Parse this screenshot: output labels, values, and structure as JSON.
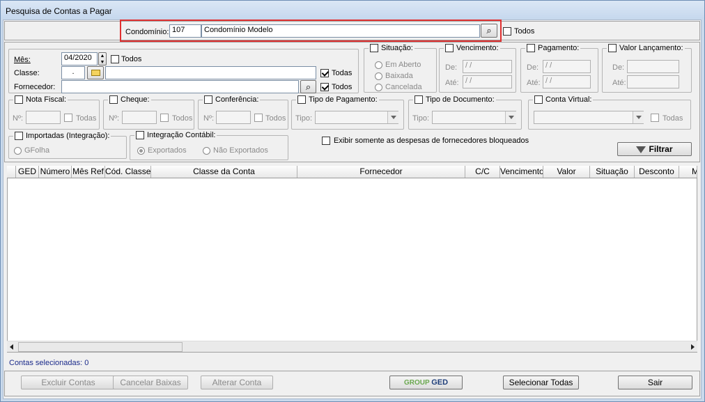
{
  "window": {
    "title": "Pesquisa de Contas a Pagar"
  },
  "condominio": {
    "label": "Condomínio:",
    "code": "107",
    "name": "Condomínio Modelo",
    "todos_label": "Todos",
    "todos_checked": false
  },
  "mes": {
    "label": "Mês:",
    "value": "04/2020",
    "todos_label": "Todos"
  },
  "classe": {
    "label": "Classe:",
    "code": ".",
    "name": "",
    "todas_label": "Todas",
    "todas_checked": true
  },
  "fornecedor": {
    "label": "Fornecedor:",
    "value": "",
    "todos_label": "Todos",
    "todos_checked": true
  },
  "situacao": {
    "label": "Situação:",
    "options": [
      "Em Aberto",
      "Baixada",
      "Cancelada"
    ]
  },
  "vencimento": {
    "label": "Vencimento:",
    "de_label": "De:",
    "ate_label": "Até:",
    "de_value": " / /",
    "ate_value": " / /"
  },
  "pagamento": {
    "label": "Pagamento:",
    "de_label": "De:",
    "ate_label": "Até:",
    "de_value": " / /",
    "ate_value": " / /"
  },
  "valor_lancamento": {
    "label": "Valor Lançamento:",
    "de_label": "De:",
    "ate_label": "Até:",
    "de_value": "",
    "ate_value": ""
  },
  "nota_fiscal": {
    "label": "Nota Fiscal:",
    "num_label": "Nº:",
    "todas_label": "Todas"
  },
  "cheque": {
    "label": "Cheque:",
    "num_label": "Nº:",
    "todos_label": "Todos"
  },
  "conferencia": {
    "label": "Conferência:",
    "num_label": "Nº:",
    "todos_label": "Todos"
  },
  "tipo_pagamento": {
    "label": "Tipo de Pagamento:",
    "tipo_label": "Tipo:",
    "value": ""
  },
  "tipo_documento": {
    "label": "Tipo de Documento:",
    "tipo_label": "Tipo:",
    "value": ""
  },
  "conta_virtual": {
    "label": "Conta Virtual:",
    "value": "",
    "todas_label": "Todas"
  },
  "importadas": {
    "label": "Importadas (Integração):",
    "option": "GFolha"
  },
  "integracao": {
    "label": "Integração Contábil:",
    "options": [
      "Exportados",
      "Não Exportados"
    ],
    "selected": "Exportados"
  },
  "bloqueados": {
    "label": "Exibir somente as despesas de fornecedores bloqueados",
    "checked": false
  },
  "filtrar_label": "Filtrar",
  "grid": {
    "columns": [
      "",
      "GED",
      "Número",
      "Mês Ref",
      "Cód. Classe",
      "Classe da Conta",
      "Fornecedor",
      "C/C",
      "Vencimento",
      "Valor",
      "Situação",
      "Desconto",
      "M"
    ],
    "rows": []
  },
  "status": {
    "selected_text": "Contas selecionadas: 0"
  },
  "buttons": {
    "excluir": "Excluir Contas",
    "cancelar": "Cancelar Baixas",
    "alterar": "Alterar Conta",
    "ged_group": "GROUP",
    "ged_name": "GED",
    "selecionar": "Selecionar Todas",
    "sair": "Sair"
  },
  "colors": {
    "titlebar": "#c6d8ee",
    "status_text": "#1a2a8a",
    "highlight_border": "#e03030"
  }
}
